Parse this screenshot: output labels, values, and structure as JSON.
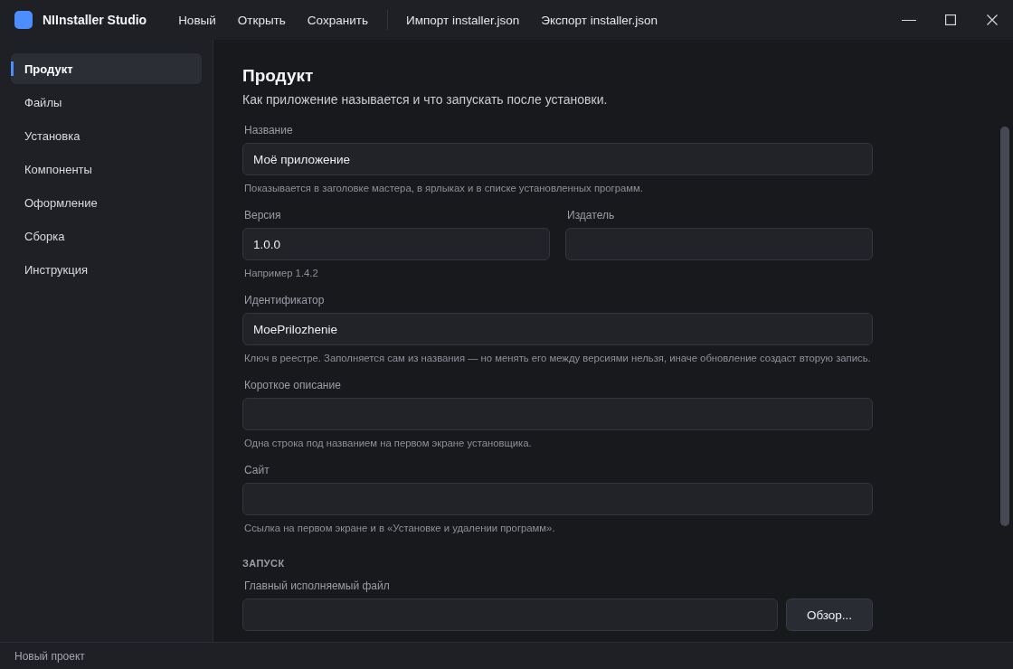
{
  "window": {
    "title": "NIInstaller Studio"
  },
  "menu": {
    "groups": [
      [
        "Новый",
        "Открыть",
        "Сохранить"
      ],
      [
        "Импорт installer.json",
        "Экспорт installer.json"
      ]
    ]
  },
  "sidebar": {
    "items": [
      {
        "label": "Продукт",
        "selected": true
      },
      {
        "label": "Файлы",
        "selected": false
      },
      {
        "label": "Установка",
        "selected": false
      },
      {
        "label": "Компоненты",
        "selected": false
      },
      {
        "label": "Оформление",
        "selected": false
      },
      {
        "label": "Сборка",
        "selected": false
      },
      {
        "label": "Инструкция",
        "selected": false
      }
    ]
  },
  "page": {
    "title": "Продукт",
    "subtitle": "Как приложение называется и что запускать после установки.",
    "rows": [
      {
        "fields": [
          {
            "kind": "text",
            "label": "Название",
            "value": "Моё приложение",
            "hint": "Показывается в заголовке мастера, в ярлыках и в списке установленных программ."
          }
        ]
      },
      {
        "fields": [
          {
            "kind": "text",
            "label": "Версия",
            "value": "1.0.0",
            "hint": "Например 1.4.2"
          },
          {
            "kind": "text",
            "label": "Издатель"
          }
        ]
      },
      {
        "fields": [
          {
            "kind": "text",
            "label": "Идентификатор",
            "value": "MoePrilozhenie",
            "hint": "Ключ в реестре. Заполняется сам из названия — но менять его между версиями нельзя, иначе обновление создаст вторую запись."
          }
        ]
      },
      {
        "fields": [
          {
            "kind": "text",
            "label": "Короткое описание",
            "hint": "Одна строка под названием на первом экране установщика."
          }
        ]
      },
      {
        "fields": [
          {
            "kind": "text",
            "label": "Сайт",
            "hint": "Ссылка на первом экране и в «Установке и удалении программ»."
          }
        ]
      }
    ],
    "sections": [
      {
        "title": "ЗАПУСК",
        "rows": [
          {
            "fields": [
              {
                "kind": "file",
                "label": "Главный исполняемый файл",
                "button": "Обзор..."
              }
            ]
          }
        ]
      }
    ]
  },
  "status_bar": {
    "text": "Новый проект"
  }
}
